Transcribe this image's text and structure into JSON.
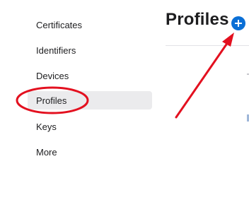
{
  "sidebar": {
    "items": [
      {
        "label": "Certificates"
      },
      {
        "label": "Identifiers"
      },
      {
        "label": "Devices"
      },
      {
        "label": "Profiles",
        "active": true
      },
      {
        "label": "Keys"
      },
      {
        "label": "More"
      }
    ]
  },
  "main": {
    "title": "Profiles",
    "add_icon": "plus-circle-icon"
  },
  "colors": {
    "accent": "#0a6fd6",
    "annotation": "#e3101f",
    "active_bg": "#ebebed"
  }
}
